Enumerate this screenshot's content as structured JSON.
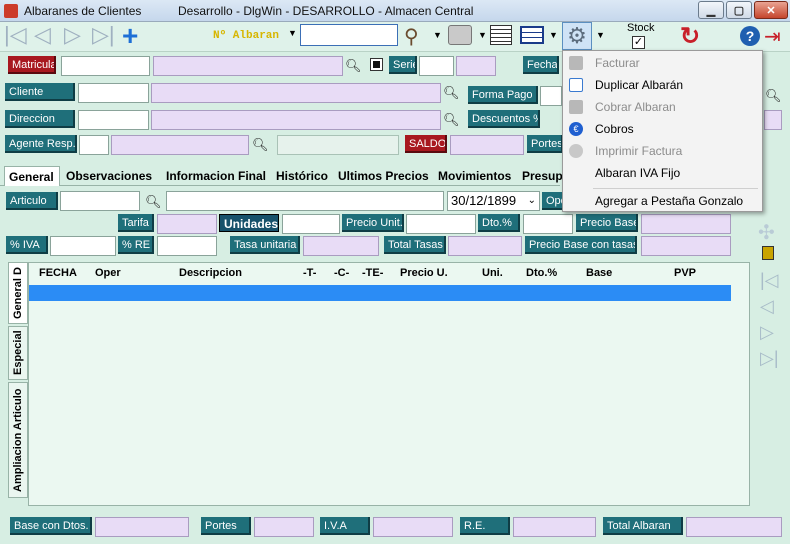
{
  "window": {
    "app_title": "Albaranes de Clientes",
    "env_title": "Desarrollo - DlgWin - DESARROLLO -  Almacen Central"
  },
  "toolbar": {
    "search_mode": "Nº Albaran",
    "search_value": "",
    "stock_label": "Stock",
    "stock_checked": true
  },
  "header_fields": {
    "matricula": "Matricula",
    "serie": "Serie",
    "fecha": "Fecha",
    "cliente": "Cliente",
    "forma_pago": "Forma Pago",
    "direccion": "Direccion",
    "descuentos": "Descuentos %",
    "agente": "Agente Resp.",
    "saldo": "SALDO",
    "portes": "Portes"
  },
  "tabs": [
    "General",
    "Observaciones",
    "Informacion Final",
    "Histórico",
    "Ultimos Precios",
    "Movimientos",
    "Presup"
  ],
  "article": {
    "articulo": "Articulo",
    "date_value": "30/12/1899",
    "oper": "Ope",
    "tarifa": "Tarifa",
    "unidades": "Unidades",
    "precio_unit": "Precio Unit.",
    "dto": "Dto.%",
    "precio_base": "Precio Base",
    "iva": "% IVA",
    "re": "% RE",
    "tasa_unitaria": "Tasa unitaria",
    "total_tasas": "Total Tasas",
    "precio_base_tasas": "Precio Base con tasas"
  },
  "grid": {
    "columns": [
      "FECHA",
      "Oper",
      "Descripcion",
      "-T-",
      "-C-",
      "-TE-",
      "Precio U.",
      "Uni.",
      "Dto.%",
      "Base",
      "PVP"
    ]
  },
  "vertical_tabs": [
    "General D",
    "Especial",
    "Ampliacion Articulo"
  ],
  "menu": {
    "items": [
      {
        "label": "Facturar",
        "enabled": false,
        "icon": "invoice-icon"
      },
      {
        "label": "Duplicar Albarán",
        "enabled": true,
        "icon": "duplicate-icon"
      },
      {
        "label": "Cobrar Albaran",
        "enabled": false,
        "icon": "charge-icon"
      },
      {
        "label": "Cobros",
        "enabled": true,
        "icon": "euro-icon"
      },
      {
        "label": "Imprimir Factura",
        "enabled": false,
        "icon": "print-icon"
      },
      {
        "label": "Albaran IVA Fijo",
        "enabled": true,
        "icon": ""
      },
      {
        "label": "Agregar a Pestaña Gonzalo",
        "enabled": true,
        "icon": ""
      }
    ]
  },
  "footer": {
    "base_dtos": "Base con Dtos.",
    "portes": "Portes",
    "iva": "I.V.A",
    "re": "R.E.",
    "total": "Total Albaran"
  },
  "colors": {
    "background": "#d7eee3",
    "label_blue": "#1f6f7a",
    "label_red": "#a8181f",
    "selection": "#2b8cf5"
  }
}
